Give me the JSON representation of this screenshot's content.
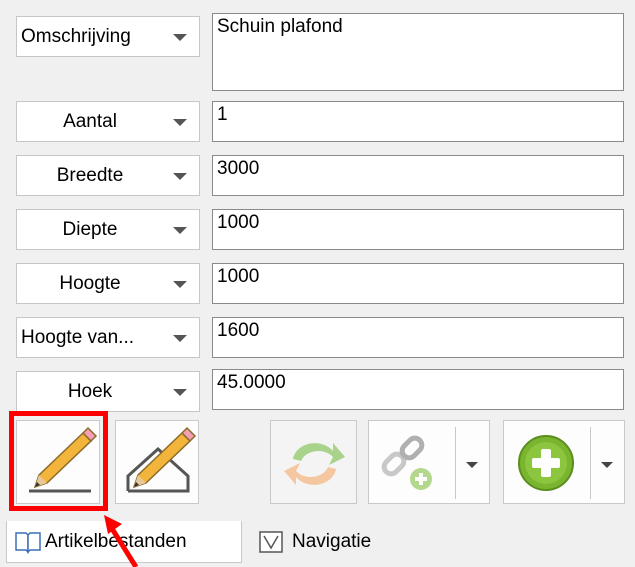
{
  "fields": [
    {
      "dropdown": "Omschrijving",
      "value": "Schuin plafond"
    },
    {
      "dropdown": "Aantal",
      "value": "1"
    },
    {
      "dropdown": "Breedte",
      "value": "3000"
    },
    {
      "dropdown": "Diepte",
      "value": "1000"
    },
    {
      "dropdown": "Hoogte",
      "value": "1000"
    },
    {
      "dropdown": "Hoogte van...",
      "value": "1600"
    },
    {
      "dropdown": "Hoek",
      "value": "45.0000"
    }
  ],
  "toolbar": {
    "buttons": [
      "pencil-icon",
      "pencil-roof-icon",
      "refresh-icon",
      "link-add-icon",
      "add-icon"
    ],
    "highlight_color": "#ff0000"
  },
  "tabs": [
    {
      "label": "Artikelbestanden",
      "icon": "book-icon",
      "active": true
    },
    {
      "label": "Navigatie",
      "icon": "navigation-icon",
      "active": false
    }
  ],
  "colors": {
    "accent_green": "#7ab52f",
    "annotation_red": "#ff0000"
  }
}
